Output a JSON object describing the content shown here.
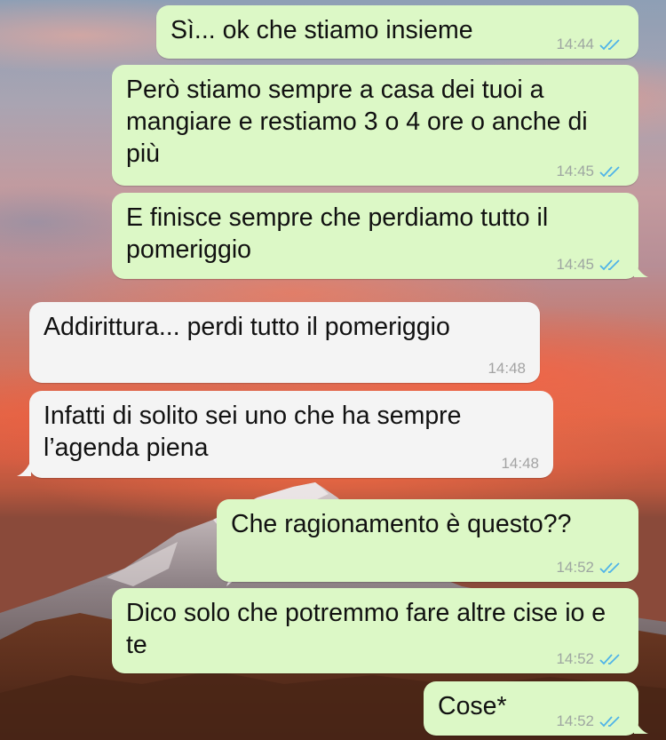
{
  "messages": [
    {
      "direction": "outgoing",
      "text": "Sì... ok che stiamo insieme",
      "time": "14:44",
      "status_icon": "double-check-icon"
    },
    {
      "direction": "outgoing",
      "text": "Però stiamo sempre a casa dei tuoi a mangiare e restiamo 3 o 4 ore o anche di più",
      "time": "14:45",
      "status_icon": "double-check-icon"
    },
    {
      "direction": "outgoing",
      "text": "E finisce sempre che perdiamo tutto il pomeriggio",
      "time": "14:45",
      "status_icon": "double-check-icon"
    },
    {
      "direction": "incoming",
      "text": "Addirittura... perdi tutto il pomeriggio",
      "time": "14:48"
    },
    {
      "direction": "incoming",
      "text": "Infatti di solito sei uno che ha sempre l’agenda piena",
      "time": "14:48"
    },
    {
      "direction": "outgoing",
      "text": "Che ragionamento è questo??",
      "time": "14:52",
      "status_icon": "double-check-icon"
    },
    {
      "direction": "outgoing",
      "text": "Dico solo che potremmo fare altre cise io e te",
      "time": "14:52",
      "status_icon": "double-check-icon"
    },
    {
      "direction": "outgoing",
      "text": "Cose*",
      "time": "14:52",
      "status_icon": "double-check-icon"
    }
  ],
  "colors": {
    "outgoing_bubble": "#dcf8c6",
    "incoming_bubble": "#f4f4f4",
    "read_tick": "#4fb3e8",
    "timestamp": "#9ea6a1"
  }
}
